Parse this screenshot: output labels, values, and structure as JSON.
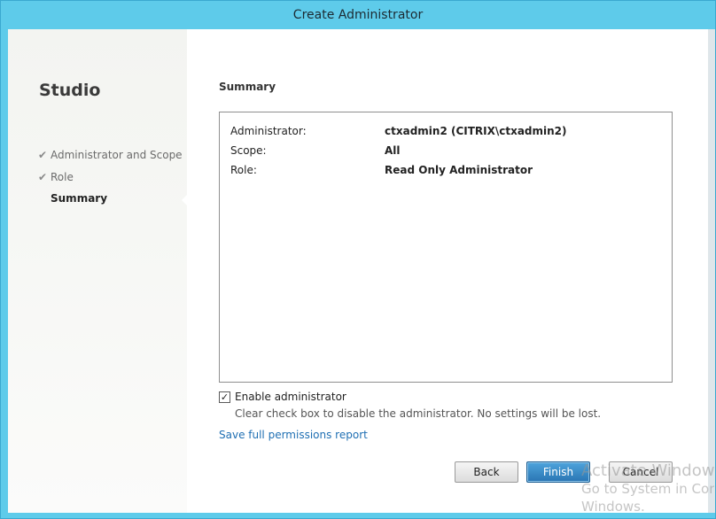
{
  "window": {
    "title": "Create Administrator"
  },
  "sidebar": {
    "brand": "Studio",
    "steps": [
      {
        "label": "Administrator and Scope",
        "done": true
      },
      {
        "label": "Role",
        "done": true
      },
      {
        "label": "Summary",
        "current": true
      }
    ],
    "check_glyph": "✔"
  },
  "main": {
    "section_title": "Summary",
    "summary": [
      {
        "key": "Administrator:",
        "value": "ctxadmin2 (CITRIX\\ctxadmin2)"
      },
      {
        "key": "Scope:",
        "value": "All"
      },
      {
        "key": "Role:",
        "value": "Read Only Administrator"
      }
    ],
    "enable": {
      "label": "Enable administrator",
      "checked": true,
      "check_glyph": "✓",
      "hint": "Clear check box to disable the administrator. No settings will be lost."
    },
    "report_link": "Save full permissions report"
  },
  "buttons": {
    "back": "Back",
    "finish": "Finish",
    "cancel": "Cancel"
  },
  "watermark": {
    "line1": "Activate Windows",
    "line2": "Go to System in Control",
    "line3": "Windows."
  },
  "colors": {
    "accent": "#5ecbea",
    "primary_button": "#2a75b3",
    "link": "#1f6fb3"
  }
}
